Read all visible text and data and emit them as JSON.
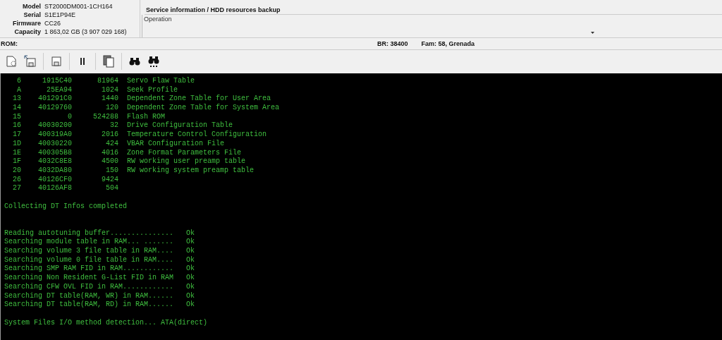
{
  "device": {
    "fields": [
      {
        "label": "Model",
        "value": "ST2000DM001-1CH164"
      },
      {
        "label": "Serial",
        "value": "S1E1P94E"
      },
      {
        "label": "Firmware",
        "value": "CC26"
      },
      {
        "label": "Capacity",
        "value": "1 863,02 GB (3 907 029 168)"
      }
    ]
  },
  "current_test": {
    "value": "Service information / HDD resources backup"
  },
  "operation": {
    "label": "Operation"
  },
  "status_bar": {
    "rom": "ROM:",
    "baud": "BR: 38400",
    "family": "Fam: 58, Grenada"
  },
  "toolbar": [
    {
      "kind": "config"
    },
    {
      "kind": "load"
    },
    {
      "kind": "sep"
    },
    {
      "kind": "save"
    },
    {
      "kind": "sep"
    },
    {
      "kind": "pause"
    },
    {
      "kind": "sep"
    },
    {
      "kind": "copy"
    },
    {
      "kind": "sep"
    },
    {
      "kind": "find"
    },
    {
      "kind": "find-next"
    }
  ],
  "console": [
    {
      "kind": "row",
      "id": "6",
      "address": "1915C40",
      "size": "81964",
      "name": "Servo Flaw Table"
    },
    {
      "kind": "row",
      "id": "A",
      "address": "25EA94",
      "size": "1024",
      "name": "Seek Profile"
    },
    {
      "kind": "row",
      "id": "13",
      "address": "401291C0",
      "size": "1440",
      "name": "Dependent Zone Table for User Area"
    },
    {
      "kind": "row",
      "id": "14",
      "address": "40129760",
      "size": "120",
      "name": "Dependent Zone Table for System Area"
    },
    {
      "kind": "row",
      "id": "15",
      "address": "0",
      "size": "524288",
      "name": "Flash ROM"
    },
    {
      "kind": "row",
      "id": "16",
      "address": "40030200",
      "size": "32",
      "name": "Drive Configuration Table"
    },
    {
      "kind": "row",
      "id": "17",
      "address": "400319A0",
      "size": "2016",
      "name": "Temperature Control Configuration"
    },
    {
      "kind": "row",
      "id": "1D",
      "address": "40030220",
      "size": "424",
      "name": "VBAR Configuration File"
    },
    {
      "kind": "row",
      "id": "1E",
      "address": "400305B8",
      "size": "4016",
      "name": "Zone Format Parameters File"
    },
    {
      "kind": "row",
      "id": "1F",
      "address": "4032C8E8",
      "size": "4500",
      "name": "RW working user preamp table"
    },
    {
      "kind": "row",
      "id": "20",
      "address": "4032DA80",
      "size": "150",
      "name": "RW working system preamp table"
    },
    {
      "kind": "row",
      "id": "26",
      "address": "40126CF0",
      "size": "9424"
    },
    {
      "kind": "row",
      "id": "27",
      "address": "40126AF8",
      "size": "504"
    },
    {
      "kind": "blank"
    },
    {
      "kind": "message",
      "text": "Collecting DT Infos completed"
    },
    {
      "kind": "blank"
    },
    {
      "kind": "blank"
    },
    {
      "kind": "check",
      "text": "Reading autotuning buffer...............",
      "result": "Ok"
    },
    {
      "kind": "check",
      "text": "Searching module table in RAM... .......",
      "result": "Ok"
    },
    {
      "kind": "check",
      "text": "Searching volume 3 file table in RAM....",
      "result": "Ok"
    },
    {
      "kind": "check",
      "text": "Searching volume 0 file table in RAM....",
      "result": "Ok"
    },
    {
      "kind": "check",
      "text": "Searching SMP RAM FID in RAM............",
      "result": "Ok"
    },
    {
      "kind": "check",
      "text": "Searching Non Resident G-List FID in RAM",
      "result": "Ok"
    },
    {
      "kind": "check",
      "text": "Searching CFW OVL FID in RAM............",
      "result": "Ok"
    },
    {
      "kind": "check",
      "text": "Searching DT table(RAM, WR) in RAM......",
      "result": "Ok"
    },
    {
      "kind": "check",
      "text": "Searching DT table(RAM, RD) in RAM......",
      "result": "Ok"
    },
    {
      "kind": "blank"
    },
    {
      "kind": "message",
      "text": "System Files I/O method detection... ATA(direct)"
    }
  ]
}
